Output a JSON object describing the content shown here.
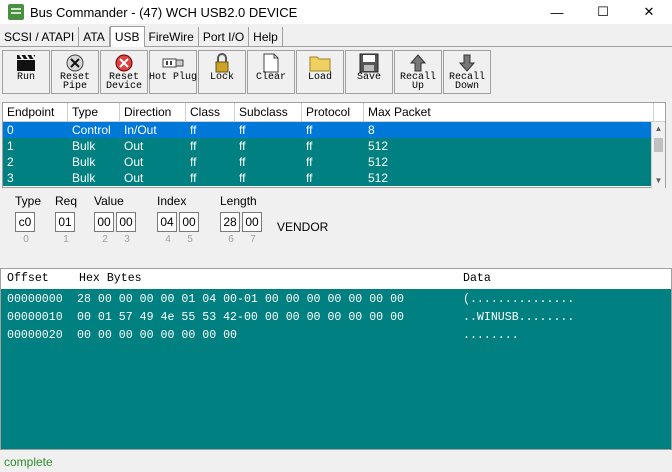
{
  "window": {
    "title": "Bus Commander - (47) WCH USB2.0 DEVICE",
    "minimize": "—",
    "maximize": "☐",
    "close": "✕"
  },
  "tabs": [
    "SCSI / ATAPI",
    "ATA",
    "USB",
    "FireWire",
    "Port I/O",
    "Help"
  ],
  "active_tab": "USB",
  "toolbar": [
    {
      "line1": "Run",
      "line2": ""
    },
    {
      "line1": "Reset",
      "line2": "Pipe"
    },
    {
      "line1": "Reset",
      "line2": "Device"
    },
    {
      "line1": "Hot Plug",
      "line2": ""
    },
    {
      "line1": "Lock",
      "line2": ""
    },
    {
      "line1": "Clear",
      "line2": ""
    },
    {
      "line1": "Load",
      "line2": ""
    },
    {
      "line1": "Save",
      "line2": ""
    },
    {
      "line1": "Recall",
      "line2": "Up"
    },
    {
      "line1": "Recall",
      "line2": "Down"
    }
  ],
  "endpoints": {
    "columns": [
      "Endpoint",
      "Type",
      "Direction",
      "Class",
      "Subclass",
      "Protocol",
      "Max Packet"
    ],
    "rows": [
      [
        "0",
        "Control",
        "In/Out",
        "ff",
        "ff",
        "ff",
        "8"
      ],
      [
        "1",
        "Bulk",
        "Out",
        "ff",
        "ff",
        "ff",
        "512"
      ],
      [
        "2",
        "Bulk",
        "Out",
        "ff",
        "ff",
        "ff",
        "512"
      ],
      [
        "3",
        "Bulk",
        "Out",
        "ff",
        "ff",
        "ff",
        "512"
      ]
    ],
    "selected_row": 0
  },
  "setup": {
    "type_label": "Type",
    "type": [
      "c0"
    ],
    "type_idx": [
      "0"
    ],
    "req_label": "Req",
    "req": [
      "01"
    ],
    "req_idx": [
      "1"
    ],
    "value_label": "Value",
    "value": [
      "00",
      "00"
    ],
    "value_idx": [
      "2",
      "3"
    ],
    "index_label": "Index",
    "index": [
      "04",
      "00"
    ],
    "index_idx": [
      "4",
      "5"
    ],
    "length_label": "Length",
    "length": [
      "28",
      "00"
    ],
    "length_idx": [
      "6",
      "7"
    ],
    "vendor": "VENDOR"
  },
  "hex": {
    "offset_label": "Offset",
    "bytes_label": "Hex Bytes",
    "data_label": "Data",
    "rows": [
      {
        "offset": "00000000",
        "bytes": "28 00 00 00 00 01 04 00-01 00 00 00 00 00 00 00",
        "ascii": "(..............."
      },
      {
        "offset": "00000010",
        "bytes": "00 01 57 49 4e 55 53 42-00 00 00 00 00 00 00 00",
        "ascii": "..WINUSB........"
      },
      {
        "offset": "00000020",
        "bytes": "00 00 00 00 00 00 00 00",
        "ascii": "........"
      }
    ]
  },
  "status": "complete"
}
